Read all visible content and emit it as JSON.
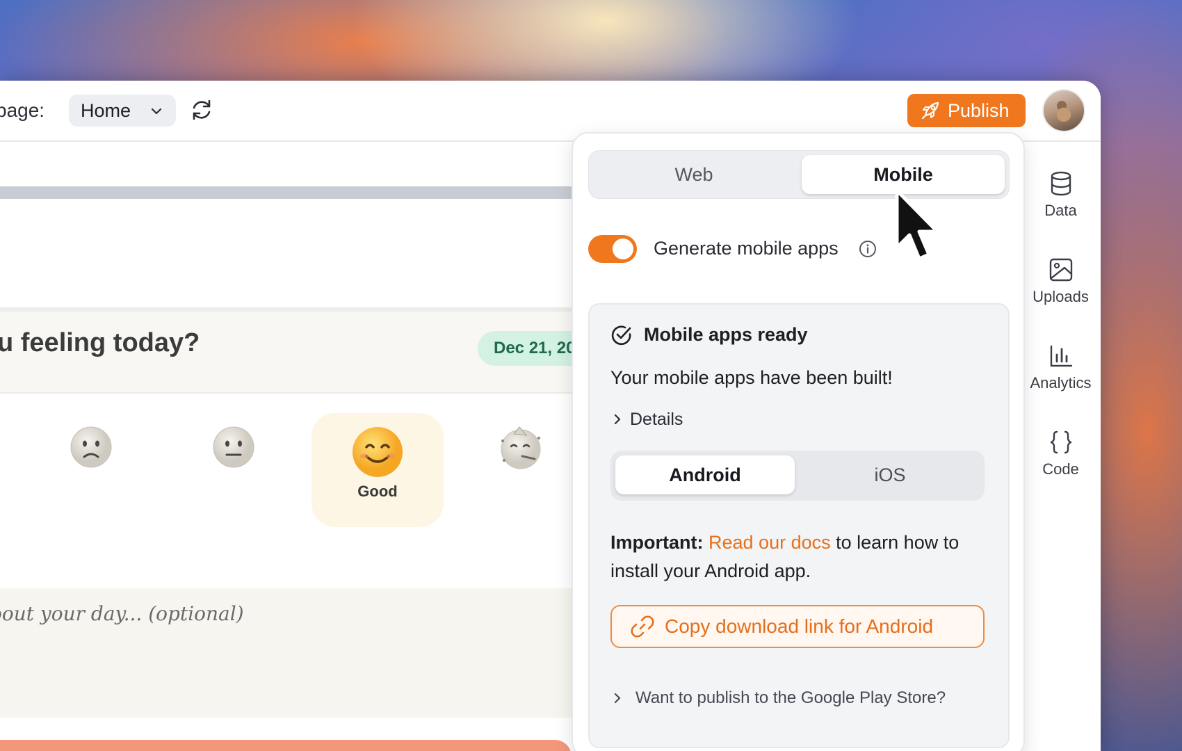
{
  "toolbar": {
    "page_label": "page:",
    "page_select_value": "Home",
    "publish_label": "Publish"
  },
  "preview": {
    "question": "u feeling today?",
    "date": "Dec 21, 20",
    "selected_mood_label": "Good",
    "notes_placeholder": "oout your day... (optional)"
  },
  "sidebar": {
    "items": [
      {
        "label": "Data",
        "icon": "database-icon"
      },
      {
        "label": "Uploads",
        "icon": "image-icon"
      },
      {
        "label": "Analytics",
        "icon": "bar-chart-icon"
      },
      {
        "label": "Code",
        "icon": "braces-icon"
      }
    ]
  },
  "popover": {
    "tabs": [
      "Web",
      "Mobile"
    ],
    "active_tab": "Mobile",
    "toggle_label": "Generate mobile apps",
    "toggle_on": true,
    "status_title": "Mobile apps ready",
    "status_desc": "Your mobile apps have been built!",
    "details_label": "Details",
    "platforms": [
      "Android",
      "iOS"
    ],
    "active_platform": "Android",
    "important_prefix": "Important:",
    "docs_link": "Read our docs",
    "important_suffix": "to learn how to install your Android app.",
    "copy_button": "Copy download link for Android",
    "play_store_label": "Want to publish to the Google Play Store?"
  },
  "colors": {
    "accent": "#f0771e",
    "date_pill_bg": "#d3f2e3",
    "date_pill_text": "#1e6b4b"
  }
}
